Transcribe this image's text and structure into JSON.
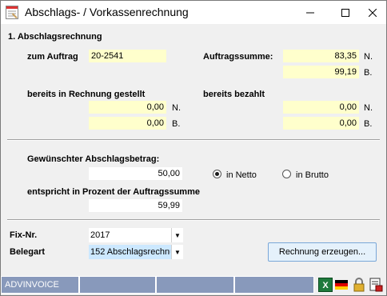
{
  "window": {
    "title": "Abschlags- / Vorkassenrechnung"
  },
  "section1": {
    "heading": "1. Abschlagsrechnung",
    "zum_auftrag_label": "zum Auftrag",
    "zum_auftrag_value": "20-2541",
    "auftragssumme_label": "Auftragssumme:",
    "auftragssumme_n": "83,35",
    "auftragssumme_b": "99,19",
    "bereits_rechnung_label": "bereits in Rechnung gestellt",
    "bereits_rechnung_n": "0,00",
    "bereits_rechnung_b": "0,00",
    "bereits_bezahlt_label": "bereits bezahlt",
    "bereits_bezahlt_n": "0,00",
    "bereits_bezahlt_b": "0,00",
    "unit_n": "N.",
    "unit_b": "B."
  },
  "section2": {
    "betrag_label": "Gewünschter Abschlagsbetrag:",
    "betrag_value": "50,00",
    "radio_netto": "in Netto",
    "radio_brutto": "in Brutto",
    "selected": "netto",
    "prozent_label": "entspricht in Prozent der Auftragssumme",
    "prozent_value": "59,99"
  },
  "section3": {
    "fix_label": "Fix-Nr.",
    "fix_value": "2017",
    "belegart_label": "Belegart",
    "belegart_value": "152 Abschlagsrechnu",
    "button_label": "Rechnung erzeugen..."
  },
  "statusbar": {
    "app": "ADVINVOICE"
  }
}
